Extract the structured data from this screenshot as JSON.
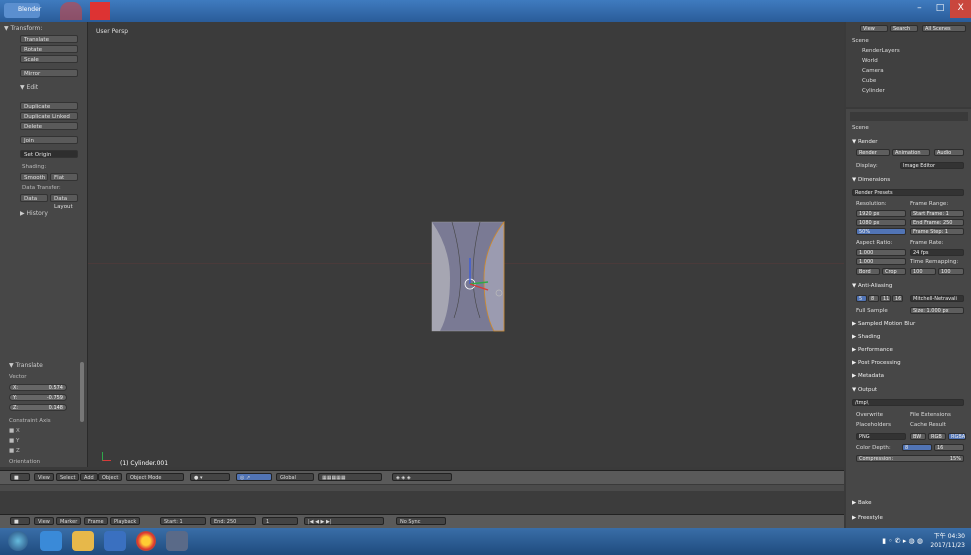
{
  "window": {
    "app_label": "Blender",
    "btn_min": "–",
    "btn_max": "□",
    "btn_close": "X"
  },
  "toolshelf": {
    "transform_header": "▼ Transform:",
    "transform_buttons": [
      "Translate",
      "Rotate",
      "Scale",
      "Mirror"
    ],
    "edit_header": "▼ Edit",
    "edit_buttons": [
      "Duplicate",
      "Duplicate Linked",
      "Delete",
      "Join"
    ],
    "set_origin": "Set Origin",
    "shading_label": "Shading:",
    "smooth": "Smooth",
    "flat": "Flat",
    "data_transfer_label": "Data Transfer:",
    "data": "Data",
    "data_layout": "Data Layout",
    "history": "▶ History",
    "translate_op": "▼ Translate",
    "vector_label": "Vector",
    "vector": [
      {
        "axis": "X:",
        "value": "0.574"
      },
      {
        "axis": "Y:",
        "value": "-0.759"
      },
      {
        "axis": "Z:",
        "value": "0.148"
      }
    ],
    "constraint_axis_label": "Constraint Axis",
    "constraint_axes": [
      "X",
      "Y",
      "Z"
    ],
    "orientation_label": "Orientation"
  },
  "viewport": {
    "title": "User Persp",
    "object_name": "(1) Cylinder.001"
  },
  "view_header": {
    "items": [
      "View",
      "Select",
      "Add",
      "Object"
    ],
    "mode": "Object Mode",
    "orientation": "Global"
  },
  "timeline_header": {
    "items": [
      "View",
      "Marker",
      "Frame",
      "Playback"
    ],
    "start": "Start:",
    "start_val": "1",
    "end": "End:",
    "end_val": "250",
    "current": "1",
    "sync": "No Sync"
  },
  "outliner": {
    "buttons": [
      "View",
      "Search",
      "All Scenes"
    ],
    "items": [
      "Scene",
      "RenderLayers",
      "World",
      "Camera",
      "Cube",
      "Cylinder"
    ]
  },
  "properties": {
    "scene": "Scene",
    "render_header": "▼ Render",
    "render_btns": [
      "Render",
      "Animation",
      "Audio"
    ],
    "display_label": "Display:",
    "display_val": "Image Editor",
    "dimensions_header": "▼ Dimensions",
    "presets": "Render Presets",
    "resolution_label": "Resolution:",
    "res_x": "1920 px",
    "res_y": "1080 px",
    "res_pct": "50%",
    "frame_range_label": "Frame Range:",
    "start_frame": "Start Frame: 1",
    "end_frame": "End Frame: 250",
    "frame_step": "Frame Step: 1",
    "aspect_label": "Aspect Ratio:",
    "asp_x": "1.000",
    "asp_y": "1.000",
    "frame_rate_label": "Frame Rate:",
    "fps": "24 fps",
    "time_remap_label": "Time Remapping:",
    "border": "Bord",
    "crop": "Crop",
    "old": "100",
    "new": "100",
    "aa_header": "▼ Anti-Aliasing",
    "aa_samples": [
      "5",
      "8",
      "11",
      "16"
    ],
    "aa_filter": "Mitchell-Netravali",
    "full_sample": "Full Sample",
    "size": "Size: 1.000 px",
    "sampled_mb": "▶ Sampled Motion Blur",
    "sections": [
      "▶ Shading",
      "▶ Performance",
      "▶ Post Processing",
      "▶ Metadata"
    ],
    "output_header": "▼ Output",
    "output_path": "/tmp\\",
    "overwrite": "Overwrite",
    "file_ext": "File Extensions",
    "placeholders": "Placeholders",
    "cache_result": "Cache Result",
    "format": "PNG",
    "bw": "BW",
    "rgb": "RGB",
    "rgba": "RGBA",
    "color_depth_label": "Color Depth:",
    "depth_8": "8",
    "depth_16": "16",
    "compression": "Compression:",
    "compression_val": "15%",
    "bake": "▶ Bake",
    "freestyle": "▶ Freestyle"
  },
  "taskbar": {
    "time": "下午 04:30",
    "date": "2017/11/23"
  }
}
